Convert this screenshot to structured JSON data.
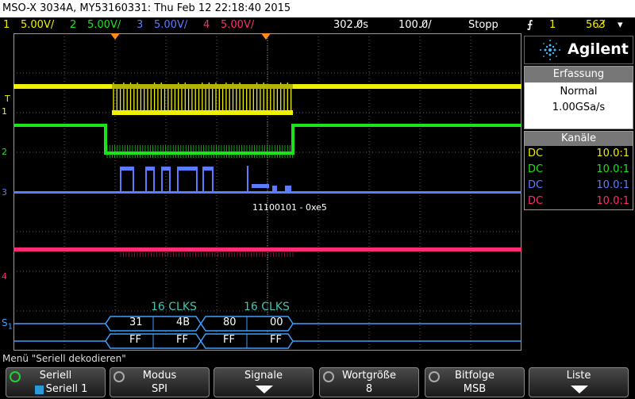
{
  "title": "MSO-X 3034A, MY53160331: Thu Feb 12 22:18:40 2015",
  "status": {
    "ch1": {
      "num": "1",
      "scale": "5.00V/"
    },
    "ch2": {
      "num": "2",
      "scale": "5.00V/"
    },
    "ch3": {
      "num": "3",
      "scale": "5.00V/"
    },
    "ch4": {
      "num": "4",
      "scale": "5.00V/"
    },
    "delay": "302.0̸s",
    "timebase": "100.0̸/",
    "run": "Stopp",
    "trig_channel": "1",
    "trig_level": "563̸"
  },
  "brand": "Agilent",
  "acquisition": {
    "header": "Erfassung",
    "mode": "Normal",
    "rate": "1.00GSa/s"
  },
  "channels": {
    "header": "Kanäle",
    "rows": [
      {
        "coupling": "DC",
        "probe": "10.0:1",
        "color": "#f0f000"
      },
      {
        "coupling": "DC",
        "probe": "10.0:1",
        "color": "#19e619"
      },
      {
        "coupling": "DC",
        "probe": "10.0:1",
        "color": "#5b7cff"
      },
      {
        "coupling": "DC",
        "probe": "10.0:1",
        "color": "#ff2a7a"
      }
    ]
  },
  "colors": {
    "ch1": "#f0f000",
    "ch2": "#19e619",
    "ch3": "#5b7cff",
    "ch4": "#ff2a7a",
    "serial": "#3aa0ff",
    "cursor": "#ff8c1a",
    "clk_label": "#3ec6b0"
  },
  "markers": {
    "t": "T",
    "ch1": "1",
    "ch2": "2",
    "ch3": "3",
    "ch4": "4",
    "s1": "S",
    "s1_sub": "1"
  },
  "annotation": "11100101 - 0xe5",
  "serial": {
    "clks": [
      "16 CLKS",
      "16 CLKS"
    ],
    "mosi": [
      "31",
      "4B",
      "80",
      "00"
    ],
    "miso": [
      "FF",
      "FF",
      "FF",
      "FF"
    ]
  },
  "menu": "Menü \"Seriell dekodieren\"",
  "softkeys": [
    {
      "label": "Seriell",
      "value": "Seriell 1"
    },
    {
      "label": "Modus",
      "value": "SPI"
    },
    {
      "label": "Signale",
      "value": ""
    },
    {
      "label": "Wortgröße",
      "value": "8"
    },
    {
      "label": "Bitfolge",
      "value": "MSB"
    },
    {
      "label": "Liste",
      "value": ""
    }
  ]
}
